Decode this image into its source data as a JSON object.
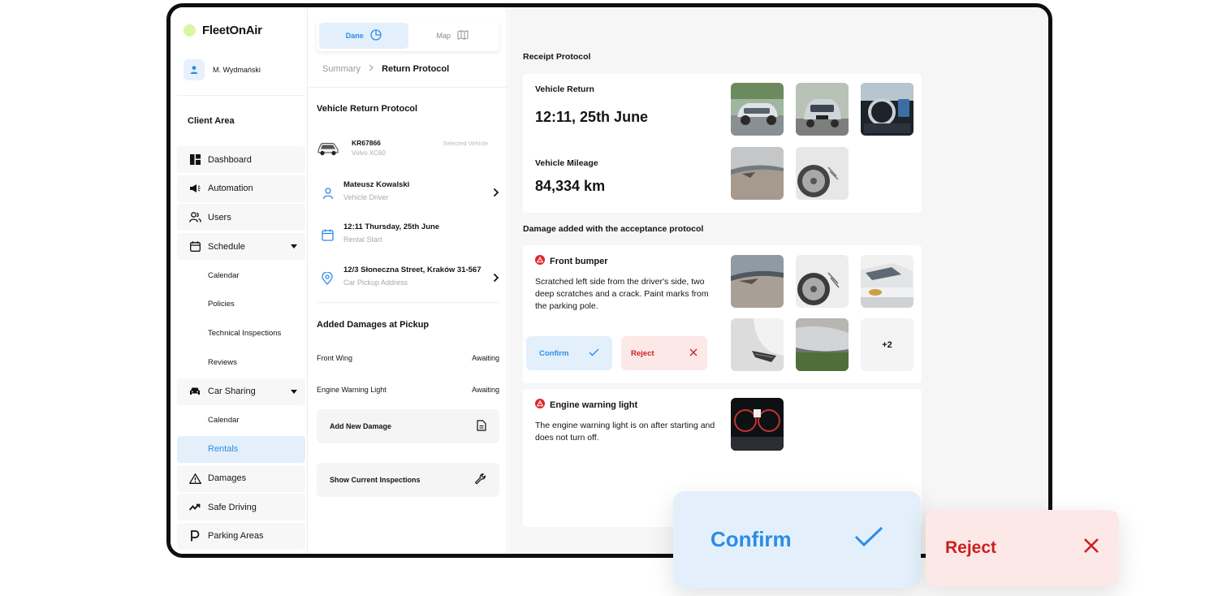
{
  "app": {
    "name": "FleetOnAir",
    "brand_dot_color": "#d8f7a0",
    "accent": "#2d8ce6",
    "danger": "#cc2222"
  },
  "user": {
    "name": "M. Wydmański"
  },
  "sidebar": {
    "section": "Client Area",
    "items": [
      {
        "label": "Dashboard",
        "icon": "dashboard-icon"
      },
      {
        "label": "Automation",
        "icon": "megaphone-icon"
      },
      {
        "label": "Users",
        "icon": "users-icon"
      },
      {
        "label": "Schedule",
        "icon": "calendar-icon",
        "expanded": true,
        "children": [
          "Calendar",
          "Policies",
          "Technical Inspections",
          "Reviews"
        ]
      },
      {
        "label": "Car Sharing",
        "icon": "car-icon",
        "expanded": true,
        "children": [
          "Calendar",
          "Rentals"
        ],
        "active_child": "Rentals"
      },
      {
        "label": "Damages",
        "icon": "warning-icon"
      },
      {
        "label": "Safe Driving",
        "icon": "trend-icon"
      },
      {
        "label": "Parking Areas",
        "icon": "parking-icon"
      }
    ]
  },
  "middle": {
    "tabs": [
      {
        "label": "Dane",
        "icon": "pie-chart-icon",
        "active": true
      },
      {
        "label": "Map",
        "icon": "map-icon",
        "active": false
      }
    ],
    "breadcrumb": {
      "parent": "Summary",
      "current": "Return Protocol"
    },
    "title": "Vehicle Return Protocol",
    "vehicle": {
      "plate": "KR67866",
      "model": "Volvo XC60",
      "tag": "Selected Vehicle"
    },
    "driver": {
      "name": "Mateusz Kowalski",
      "role": "Vehicle Driver"
    },
    "rental_start": {
      "value": "12:11 Thursday, 25th June",
      "label": "Rental Start"
    },
    "pickup": {
      "address": "12/3 Słoneczna Street, Kraków 31-567",
      "label": "Car Pickup Address"
    },
    "damages_title": "Added Damages at Pickup",
    "damages": [
      {
        "name": "Front Wing",
        "status": "Awaiting"
      },
      {
        "name": "Engine Warning Light",
        "status": "Awaiting"
      }
    ],
    "add_damage": "Add New Damage",
    "show_inspections": "Show Current Inspections"
  },
  "right": {
    "receipt_title": "Receipt Protocol",
    "return_label": "Vehicle Return",
    "return_time": "12:11, 25th June",
    "mileage_label": "Vehicle Mileage",
    "mileage": "84,334 km",
    "damage_section_title": "Damage added with the acceptance protocol",
    "damages": [
      {
        "title": "Front bumper",
        "description": "Scratched left side from the driver's side, two deep scratches and a crack. Paint marks from the parking pole.",
        "more_photos": "+2",
        "confirm": "Confirm",
        "reject": "Reject"
      },
      {
        "title": "Engine warning light",
        "description": "The engine warning light is on after starting and does not turn off."
      }
    ]
  },
  "floating": {
    "confirm": "Confirm",
    "reject": "Reject"
  }
}
